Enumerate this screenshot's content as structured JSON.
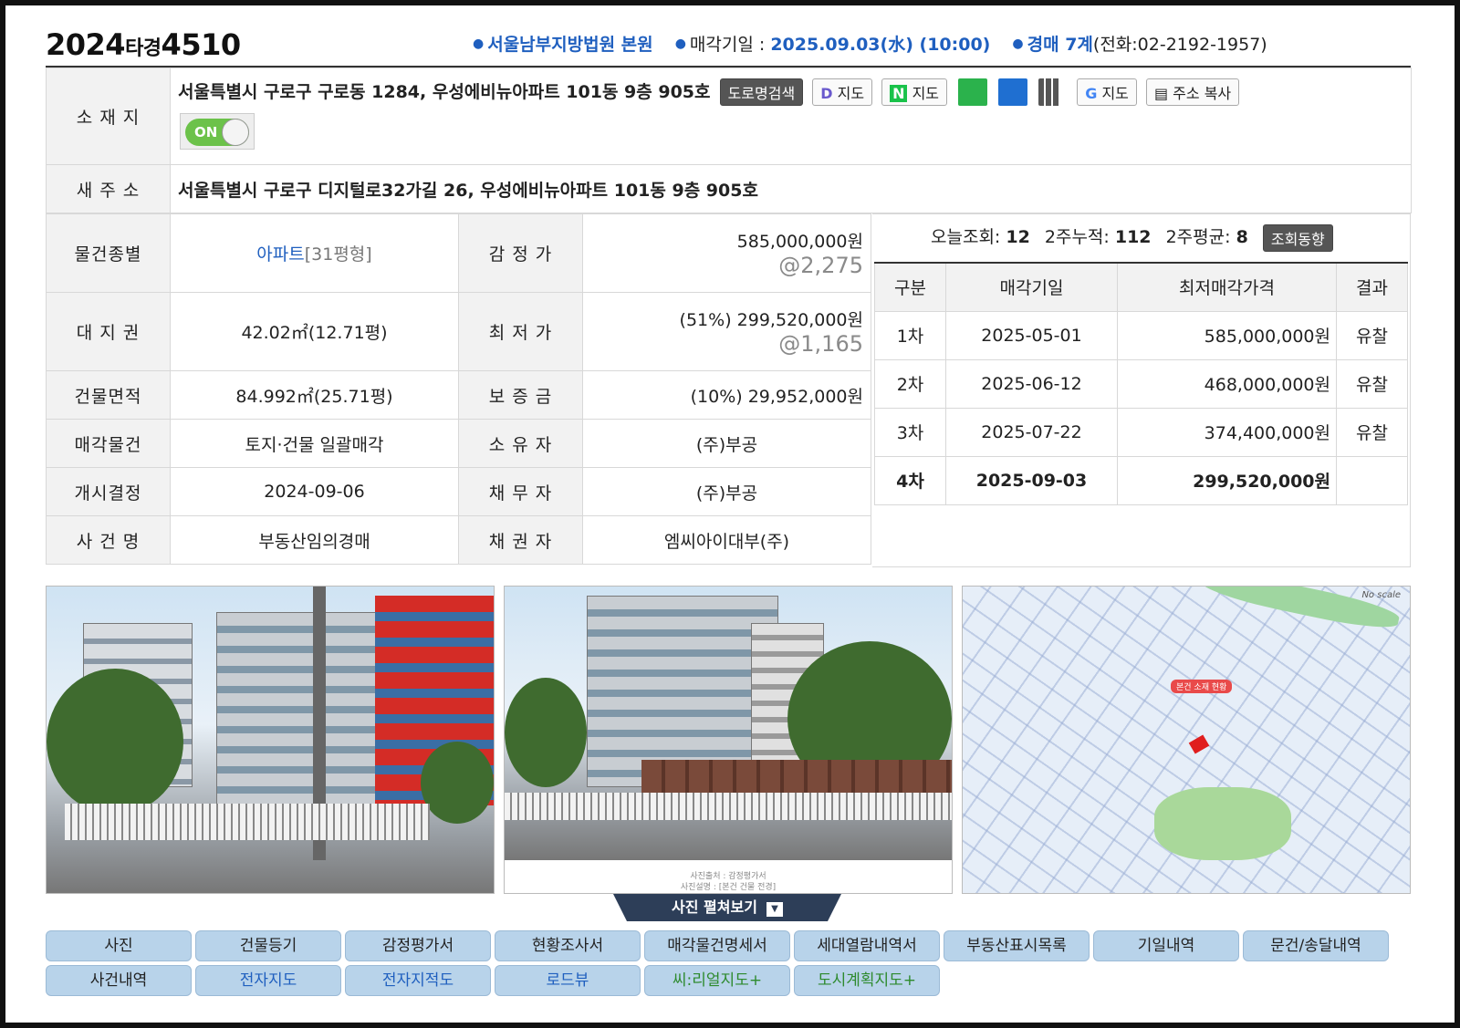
{
  "header": {
    "case_year": "2024",
    "case_type": "타경",
    "case_no": "4510",
    "court": "서울남부지방법원 본원",
    "sale_date_label": "매각기일 :",
    "sale_date": "2025.09.03(水) (10:00)",
    "dept": "경매 7계",
    "phone": "(전화:02-2192-1957)"
  },
  "location": {
    "label": "소 재 지",
    "address": "서울특별시 구로구 구로동 1284, 우성에비뉴아파트 101동 9층 905호",
    "road_search": "도로명검색",
    "daum_map": "지도",
    "naver_map": "지도",
    "google_map": "지도",
    "copy_address": "주소 복사",
    "toggle": "ON"
  },
  "new_address": {
    "label": "새 주 소",
    "value": "서울특별시 구로구 디지털로32가길 26, 우성에비뉴아파트 101동 9층 905호"
  },
  "rows": {
    "type_label": "물건종별",
    "type_value": "아파트",
    "type_size": "[31평형]",
    "appraisal_label": "감 정 가",
    "appraisal_value": "585,000,000원",
    "appraisal_sub": "@2,275",
    "land_label": "대 지 권",
    "land_value": "42.02㎡(12.71평)",
    "min_label": "최 저 가",
    "min_value": "(51%) 299,520,000원",
    "min_sub": "@1,165",
    "building_label": "건물면적",
    "building_value": "84.992㎡(25.71평)",
    "deposit_label": "보 증 금",
    "deposit_value": "(10%) 29,952,000원",
    "sale_item_label": "매각물건",
    "sale_item_value": "토지·건물 일괄매각",
    "owner_label": "소 유 자",
    "owner_value": "(주)부공",
    "start_label": "개시결정",
    "start_value": "2024-09-06",
    "debtor_label": "채 무 자",
    "debtor_value": "(주)부공",
    "case_name_label": "사 건 명",
    "case_name_value": "부동산임의경매",
    "creditor_label": "채 권 자",
    "creditor_value": "엠씨아이대부(주)"
  },
  "stats": {
    "today_label": "오늘조회:",
    "today": "12",
    "two_week_label": "2주누적:",
    "two_week": "112",
    "avg_label": "2주평균:",
    "avg": "8",
    "trend_button": "조회동향"
  },
  "history": {
    "headers": [
      "구분",
      "매각기일",
      "최저매각가격",
      "결과"
    ],
    "rows": [
      [
        "1차",
        "2025-05-01",
        "585,000,000원",
        "유찰"
      ],
      [
        "2차",
        "2025-06-12",
        "468,000,000원",
        "유찰"
      ],
      [
        "3차",
        "2025-07-22",
        "374,400,000원",
        "유찰"
      ],
      [
        "4차",
        "2025-09-03",
        "299,520,000원",
        ""
      ]
    ]
  },
  "photos": {
    "caption_line1": "사진출처 : 감정평가서",
    "caption_line2": "사진설명 : [본건 건물 전경]",
    "map_label": "본건 소재 현황",
    "map_scale": "No scale",
    "expand": "사진 펼쳐보기"
  },
  "tabs": [
    "사진",
    "건물등기",
    "감정평가서",
    "현황조사서",
    "매각물건명세서",
    "세대열람내역서",
    "부동산표시목록",
    "기일내역",
    "문건/송달내역",
    "사건내역",
    "전자지도",
    "전자지적도",
    "로드뷰",
    "씨:리얼지도+",
    "도시계획지도+"
  ],
  "colors": {
    "accent_blue": "#1f5fbf",
    "tab_bg": "#b8d3ea",
    "tab_green": "#2d8a2d"
  }
}
